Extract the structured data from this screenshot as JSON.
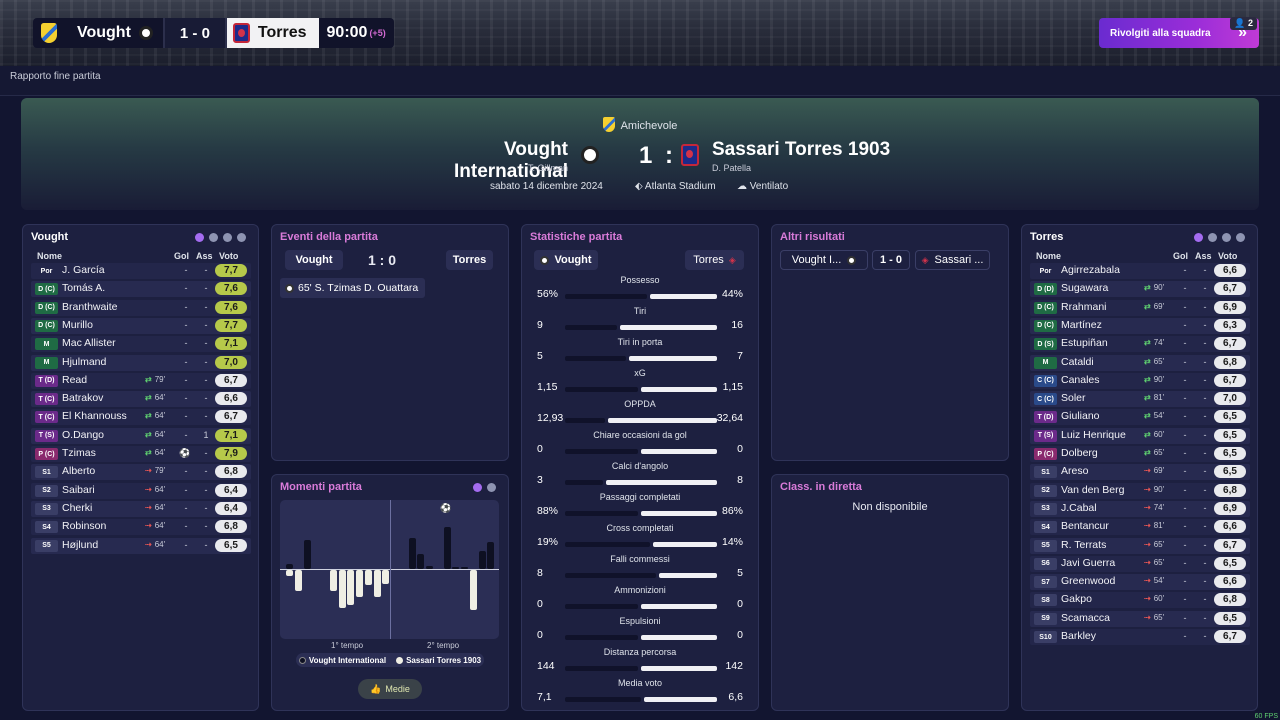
{
  "scorebar": {
    "home": "Vought",
    "score": "1 - 0",
    "away": "Torres",
    "clock": "90:00",
    "added": "(+5)"
  },
  "chat_button": {
    "label": "Rivolgiti alla squadra",
    "badge": "2"
  },
  "page_title": "Rapporto fine partita",
  "match": {
    "competition": "Amichevole",
    "home_team": "Vought International",
    "home_manager": "T. Gillman",
    "score": "1 : 0",
    "away_team": "Sassari Torres 1903",
    "away_manager": "D. Patella",
    "date": "sabato 14 dicembre 2024",
    "stadium": "Atlanta Stadium",
    "weather": "Ventilato"
  },
  "colors": {
    "accent": "#a46cf0",
    "rating_high": "#b6c94a",
    "pink": "#d97bd9",
    "sub_in": "#5fd070",
    "sub_out": "#e25555"
  },
  "home_lineup": {
    "title": "Vought",
    "headers": {
      "name": "Nome",
      "goals": "Gol",
      "assists": "Ass",
      "rating": "Voto"
    },
    "players": [
      {
        "pos": "Por",
        "name": "J. García",
        "sub": "",
        "g": "-",
        "a": "-",
        "r": "7,7",
        "hi": true,
        "posc": "#23264a"
      },
      {
        "pos": "D (C)",
        "name": "Tomás A.",
        "sub": "",
        "g": "-",
        "a": "-",
        "r": "7,6",
        "hi": true,
        "posc": "#1f6b44"
      },
      {
        "pos": "D (C)",
        "name": "Branthwaite",
        "sub": "",
        "g": "-",
        "a": "-",
        "r": "7,6",
        "hi": true,
        "posc": "#1f6b44"
      },
      {
        "pos": "D (C)",
        "name": "Murillo",
        "sub": "",
        "g": "-",
        "a": "-",
        "r": "7,7",
        "hi": true,
        "posc": "#1f6b44"
      },
      {
        "pos": "M",
        "name": "Mac Allister",
        "sub": "",
        "g": "-",
        "a": "-",
        "r": "7,1",
        "hi": true,
        "posc": "#1f6b44"
      },
      {
        "pos": "M",
        "name": "Hjulmand",
        "sub": "",
        "g": "-",
        "a": "-",
        "r": "7,0",
        "hi": true,
        "posc": "#1f6b44"
      },
      {
        "pos": "T (D)",
        "name": "Read",
        "sub": "79'",
        "g": "-",
        "a": "-",
        "r": "6,7",
        "hi": false,
        "posc": "#6b2a8a"
      },
      {
        "pos": "T (C)",
        "name": "Batrakov",
        "sub": "64'",
        "g": "-",
        "a": "-",
        "r": "6,6",
        "hi": false,
        "posc": "#6b2a8a"
      },
      {
        "pos": "T (C)",
        "name": "El Khannouss",
        "sub": "64'",
        "g": "-",
        "a": "-",
        "r": "6,7",
        "hi": false,
        "posc": "#6b2a8a"
      },
      {
        "pos": "T (S)",
        "name": "O.Dango",
        "sub": "64'",
        "g": "-",
        "a": "1",
        "r": "7,1",
        "hi": true,
        "posc": "#6b2a8a"
      },
      {
        "pos": "P (C)",
        "name": "Tzimas",
        "sub": "64'",
        "g": "ball",
        "a": "-",
        "r": "7,9",
        "hi": true,
        "posc": "#8a2a6e"
      },
      {
        "pos": "S1",
        "name": "Alberto",
        "sub": "79'",
        "out": true,
        "g": "-",
        "a": "-",
        "r": "6,8",
        "hi": false,
        "posc": "#3a3e66"
      },
      {
        "pos": "S2",
        "name": "Saibari",
        "sub": "64'",
        "out": true,
        "g": "-",
        "a": "-",
        "r": "6,4",
        "hi": false,
        "posc": "#3a3e66"
      },
      {
        "pos": "S3",
        "name": "Cherki",
        "sub": "64'",
        "out": true,
        "g": "-",
        "a": "-",
        "r": "6,4",
        "hi": false,
        "posc": "#3a3e66"
      },
      {
        "pos": "S4",
        "name": "Robinson",
        "sub": "64'",
        "out": true,
        "g": "-",
        "a": "-",
        "r": "6,8",
        "hi": false,
        "posc": "#3a3e66"
      },
      {
        "pos": "S5",
        "name": "Højlund",
        "sub": "64'",
        "out": true,
        "g": "-",
        "a": "-",
        "r": "6,5",
        "hi": false,
        "posc": "#3a3e66"
      }
    ]
  },
  "events": {
    "title": "Eventi della partita",
    "home": "Vought",
    "score": "1 : 0",
    "away": "Torres",
    "items": [
      {
        "text": "65' S. Tzimas D. Ouattara"
      }
    ]
  },
  "stats": {
    "title": "Statistiche partita",
    "home": "Vought",
    "away": "Torres",
    "rows": [
      {
        "label": "Possesso",
        "h": "56%",
        "a": "44%",
        "hf": 0.56
      },
      {
        "label": "Tiri",
        "h": "9",
        "a": "16",
        "hf": 0.36
      },
      {
        "label": "Tiri in porta",
        "h": "5",
        "a": "7",
        "hf": 0.42
      },
      {
        "label": "xG",
        "h": "1,15",
        "a": "1,15",
        "hf": 0.5
      },
      {
        "label": "OPPDA",
        "h": "12,93",
        "a": "32,64",
        "hf": 0.28
      },
      {
        "label": "Chiare occasioni da gol",
        "h": "0",
        "a": "0",
        "hf": 0.5
      },
      {
        "label": "Calci d'angolo",
        "h": "3",
        "a": "8",
        "hf": 0.27
      },
      {
        "label": "Passaggi completati",
        "h": "88%",
        "a": "86%",
        "hf": 0.5
      },
      {
        "label": "Cross completati",
        "h": "19%",
        "a": "14%",
        "hf": 0.58
      },
      {
        "label": "Falli commessi",
        "h": "8",
        "a": "5",
        "hf": 0.62
      },
      {
        "label": "Ammonizioni",
        "h": "0",
        "a": "0",
        "hf": 0.5
      },
      {
        "label": "Espulsioni",
        "h": "0",
        "a": "0",
        "hf": 0.5
      },
      {
        "label": "Distanza percorsa",
        "h": "144",
        "a": "142",
        "hf": 0.5
      },
      {
        "label": "Media voto",
        "h": "7,1",
        "a": "6,6",
        "hf": 0.52
      }
    ]
  },
  "other_results": {
    "title": "Altri risultati",
    "home": "Vought I...",
    "score": "1 - 0",
    "away": "Sassari ..."
  },
  "live_table": {
    "title": "Class. in diretta",
    "message": "Non disponibile"
  },
  "momentum": {
    "title": "Momenti partita",
    "first_half": "1° tempo",
    "second_half": "2° tempo",
    "home_legend": "Vought International",
    "away_legend": "Sassari Torres 1903",
    "button": "Medie",
    "home": [
      0.1,
      0,
      0.52,
      0,
      0,
      0,
      0,
      0,
      0,
      0,
      0,
      0,
      0,
      0,
      0.56,
      0.28,
      0.05,
      0,
      0.76,
      0.04,
      0.04,
      0,
      0.33,
      0.5
    ],
    "away": [
      0.1,
      0.39,
      0,
      0,
      0,
      0.39,
      0.69,
      0.63,
      0.49,
      0.28,
      0.49,
      0.26,
      0,
      0,
      0,
      0,
      0,
      0,
      0,
      0,
      0,
      0.73,
      0,
      0
    ]
  },
  "away_lineup": {
    "title": "Torres",
    "headers": {
      "name": "Nome",
      "goals": "Gol",
      "assists": "Ass",
      "rating": "Voto"
    },
    "players": [
      {
        "pos": "Por",
        "name": "Agirrezabala",
        "sub": "",
        "g": "-",
        "a": "-",
        "r": "6,6",
        "posc": "#23264a"
      },
      {
        "pos": "D (D)",
        "name": "Sugawara",
        "sub": "90'",
        "g": "-",
        "a": "-",
        "r": "6,7",
        "posc": "#1f6b44"
      },
      {
        "pos": "D (C)",
        "name": "Rrahmani",
        "sub": "69'",
        "g": "-",
        "a": "-",
        "r": "6,9",
        "posc": "#1f6b44"
      },
      {
        "pos": "D (C)",
        "name": "Martínez",
        "sub": "",
        "g": "-",
        "a": "-",
        "r": "6,3",
        "posc": "#1f6b44"
      },
      {
        "pos": "D (S)",
        "name": "Estupiñan",
        "sub": "74'",
        "g": "-",
        "a": "-",
        "r": "6,7",
        "posc": "#1f6b44"
      },
      {
        "pos": "M",
        "name": "Cataldi",
        "sub": "65'",
        "g": "-",
        "a": "-",
        "r": "6,8",
        "posc": "#1f6b44"
      },
      {
        "pos": "C (C)",
        "name": "Canales",
        "sub": "90'",
        "g": "-",
        "a": "-",
        "r": "6,7",
        "posc": "#2a4a8a"
      },
      {
        "pos": "C (C)",
        "name": "Soler",
        "sub": "81'",
        "g": "-",
        "a": "-",
        "r": "7,0",
        "posc": "#2a4a8a"
      },
      {
        "pos": "T (D)",
        "name": "Giuliano",
        "sub": "54'",
        "g": "-",
        "a": "-",
        "r": "6,5",
        "posc": "#6b2a8a"
      },
      {
        "pos": "T (S)",
        "name": "Luiz Henrique",
        "sub": "60'",
        "g": "-",
        "a": "-",
        "r": "6,5",
        "posc": "#6b2a8a"
      },
      {
        "pos": "P (C)",
        "name": "Dolberg",
        "sub": "65'",
        "g": "-",
        "a": "-",
        "r": "6,5",
        "posc": "#8a2a6e"
      },
      {
        "pos": "S1",
        "name": "Areso",
        "sub": "69'",
        "out": true,
        "g": "-",
        "a": "-",
        "r": "6,5",
        "posc": "#3a3e66"
      },
      {
        "pos": "S2",
        "name": "Van den Berg",
        "sub": "90'",
        "out": true,
        "g": "-",
        "a": "-",
        "r": "6,8",
        "posc": "#3a3e66"
      },
      {
        "pos": "S3",
        "name": "J.Cabal",
        "sub": "74'",
        "out": true,
        "g": "-",
        "a": "-",
        "r": "6,9",
        "posc": "#3a3e66"
      },
      {
        "pos": "S4",
        "name": "Bentancur",
        "sub": "81'",
        "out": true,
        "g": "-",
        "a": "-",
        "r": "6,6",
        "posc": "#3a3e66"
      },
      {
        "pos": "S5",
        "name": "R. Terrats",
        "sub": "65'",
        "out": true,
        "g": "-",
        "a": "-",
        "r": "6,7",
        "posc": "#3a3e66"
      },
      {
        "pos": "S6",
        "name": "Javi Guerra",
        "sub": "65'",
        "out": true,
        "g": "-",
        "a": "-",
        "r": "6,5",
        "posc": "#3a3e66"
      },
      {
        "pos": "S7",
        "name": "Greenwood",
        "sub": "54'",
        "out": true,
        "g": "-",
        "a": "-",
        "r": "6,6",
        "posc": "#3a3e66"
      },
      {
        "pos": "S8",
        "name": "Gakpo",
        "sub": "60'",
        "out": true,
        "g": "-",
        "a": "-",
        "r": "6,8",
        "posc": "#3a3e66"
      },
      {
        "pos": "S9",
        "name": "Scamacca",
        "sub": "65'",
        "out": true,
        "g": "-",
        "a": "-",
        "r": "6,5",
        "posc": "#3a3e66"
      },
      {
        "pos": "S10",
        "name": "Barkley",
        "sub": "",
        "g": "-",
        "a": "-",
        "r": "6,7",
        "posc": "#3a3e66"
      }
    ]
  },
  "fps": "60 FPS"
}
